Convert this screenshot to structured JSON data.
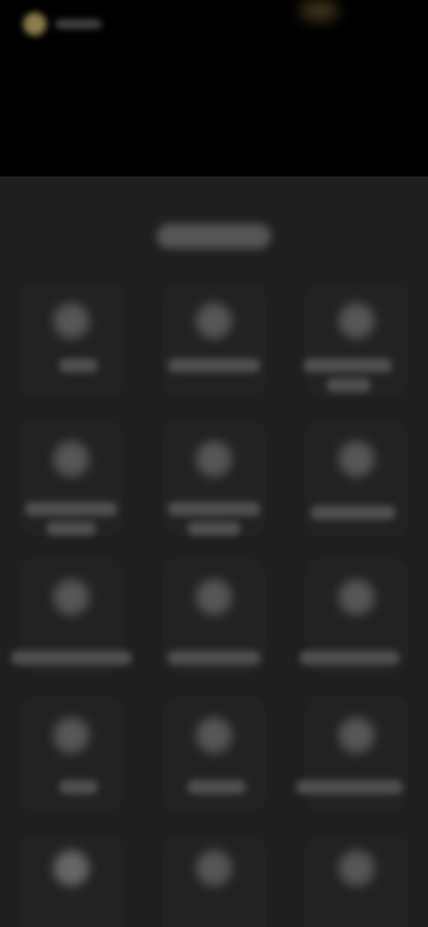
{
  "header": {
    "clock_text": "",
    "status_left_label": "",
    "status_right_label": ""
  },
  "pill": {
    "label": ""
  },
  "grid": {
    "tiles": [
      {
        "label": ""
      },
      {
        "label": ""
      },
      {
        "label": ""
      },
      {
        "label": ""
      },
      {
        "label": ""
      },
      {
        "label": ""
      },
      {
        "label": ""
      },
      {
        "label": ""
      },
      {
        "label": ""
      },
      {
        "label": ""
      },
      {
        "label": ""
      },
      {
        "label": ""
      },
      {
        "label": ""
      },
      {
        "label": ""
      },
      {
        "label": ""
      }
    ]
  }
}
